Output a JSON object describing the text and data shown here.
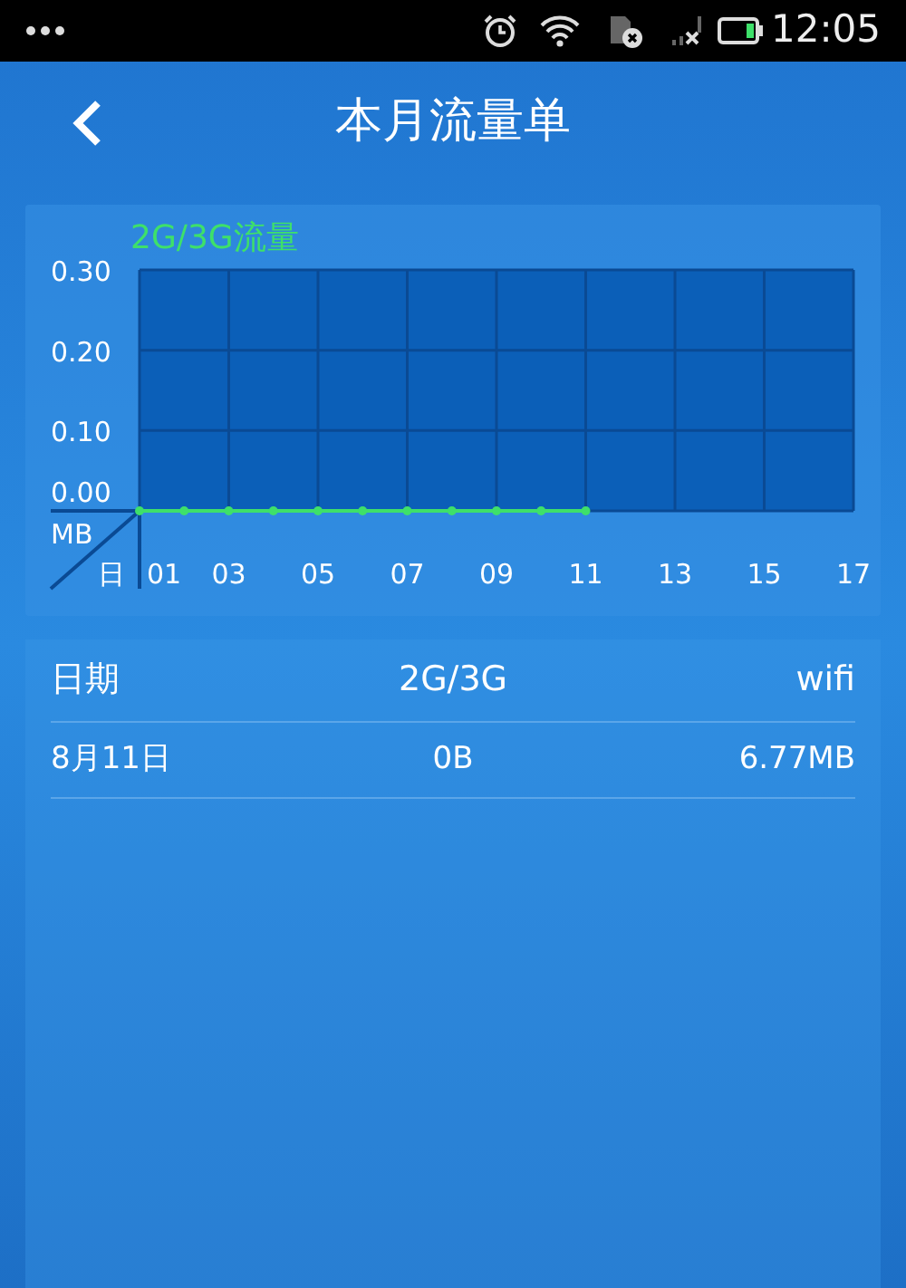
{
  "status_bar": {
    "time": "12:05"
  },
  "header": {
    "title": "本月流量单"
  },
  "chart_panel": {
    "chart_data": {
      "type": "line",
      "title": "2G/3G流量",
      "xlabel": "日",
      "ylabel": "MB",
      "x": [
        1,
        2,
        3,
        4,
        5,
        6,
        7,
        8,
        9,
        10,
        11
      ],
      "grid": true,
      "series": [
        {
          "color": "#3ee06a",
          "marker": "circle",
          "values": [
            0,
            0,
            0,
            0,
            0,
            0,
            0,
            0,
            0,
            0,
            0
          ]
        }
      ],
      "xlim": [
        1,
        17
      ],
      "ylim": [
        0,
        0.3
      ],
      "xticks": [
        {
          "value": 1,
          "label": "01"
        },
        {
          "value": 3,
          "label": "03"
        },
        {
          "value": 5,
          "label": "05"
        },
        {
          "value": 7,
          "label": "07"
        },
        {
          "value": 9,
          "label": "09"
        },
        {
          "value": 11,
          "label": "11"
        },
        {
          "value": 13,
          "label": "13"
        },
        {
          "value": 15,
          "label": "15"
        },
        {
          "value": 17,
          "label": "17"
        }
      ],
      "yticks": [
        {
          "value": 0,
          "label": "0.00"
        },
        {
          "value": 0.1,
          "label": "0.10"
        },
        {
          "value": 0.2,
          "label": "0.20"
        },
        {
          "value": 0.3,
          "label": "0.30"
        }
      ]
    }
  },
  "table": {
    "columns": [
      "日期",
      "2G/3G",
      "wifi"
    ],
    "rows": [
      [
        "8月11日",
        "0B",
        "6.77MB"
      ]
    ]
  }
}
